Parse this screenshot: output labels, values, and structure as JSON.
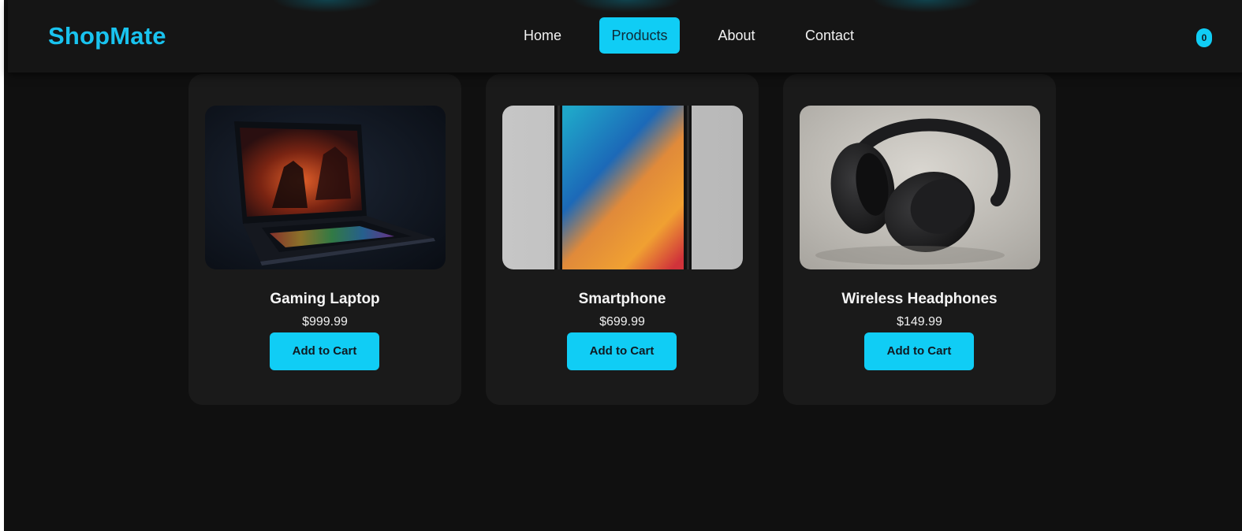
{
  "header": {
    "logo": "ShopMate",
    "nav": [
      {
        "label": "Home",
        "active": false
      },
      {
        "label": "Products",
        "active": true
      },
      {
        "label": "About",
        "active": false
      },
      {
        "label": "Contact",
        "active": false
      }
    ],
    "cart_count": "0"
  },
  "products": [
    {
      "name": "Gaming Laptop",
      "price": "$999.99",
      "button": "Add to Cart",
      "image": "gaming-laptop-image"
    },
    {
      "name": "Smartphone",
      "price": "$699.99",
      "button": "Add to Cart",
      "image": "smartphone-image"
    },
    {
      "name": "Wireless Headphones",
      "price": "$149.99",
      "button": "Add to Cart",
      "image": "headphones-image"
    }
  ],
  "colors": {
    "accent": "#10cdf5",
    "logo": "#19c3ef",
    "background": "#101010",
    "card": "#1a1a1a",
    "header": "#151515"
  }
}
